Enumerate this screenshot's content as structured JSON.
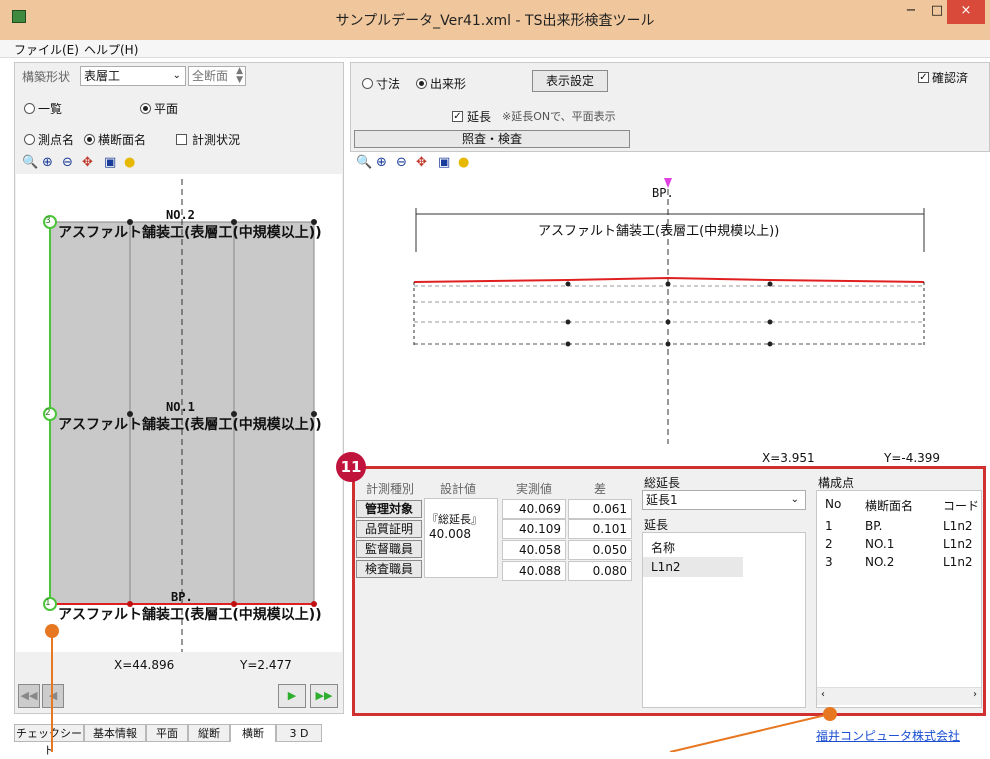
{
  "window": {
    "title": "サンプルデータ_Ver41.xml - TS出来形検査ツール",
    "min_label": "−",
    "max_label": "□",
    "close_label": "×",
    "accent_color": "#d94a3a"
  },
  "menu": {
    "file": "ファイル(E)",
    "help": "ヘルプ(H)"
  },
  "left_panel": {
    "shape_label": "構築形状",
    "shape_value": "表層工",
    "section_value": "全断面",
    "radio_list": "一覧",
    "radio_plan": "平面",
    "radio_point_name": "測点名",
    "radio_section_name": "横断面名",
    "check_measure": "計測状況",
    "drawing": {
      "sections": [
        {
          "station": "NO.2",
          "label": "アスファルト舗装工(表層工(中規模以上))",
          "marker": "3"
        },
        {
          "station": "NO.1",
          "label": "アスファルト舗装工(表層工(中規模以上))",
          "marker": "2"
        },
        {
          "station": "BP.",
          "label": "アスファルト舗装工(表層工(中規模以上))",
          "marker": "1"
        }
      ]
    },
    "coord_x": "X=44.896",
    "coord_y": "Y=2.477"
  },
  "right_panel": {
    "radio_dimension": "寸法",
    "radio_result": "出来形",
    "display_settings": "表示設定",
    "check_extension": "延長",
    "extension_note": "※延長ONで、平面表示",
    "check_title": "照査・検査",
    "confirmed_label": "確認済",
    "drawing": {
      "station": "BP.",
      "label": "アスファルト舗装工(表層工(中規模以上))"
    },
    "coord_x": "X=3.951",
    "coord_y": "Y=-4.399"
  },
  "callout": {
    "number": "11",
    "company_link": "福井コンピュータ株式会社"
  },
  "measure_table": {
    "headers": [
      "計測種別",
      "設計値",
      "実測値",
      "差"
    ],
    "types": [
      "管理対象",
      "品質証明",
      "監督職員",
      "検査職員"
    ],
    "design_label": "『総延長』",
    "design_value": "40.008",
    "rows": [
      {
        "measured": "40.069",
        "diff": "0.061"
      },
      {
        "measured": "40.109",
        "diff": "0.101"
      },
      {
        "measured": "40.058",
        "diff": "0.050"
      },
      {
        "measured": "40.088",
        "diff": "0.080"
      }
    ]
  },
  "total_length": {
    "label": "総延長",
    "selected": "延長1",
    "extension_label": "延長",
    "name_header": "名称",
    "name_value": "L1n2"
  },
  "points": {
    "label": "構成点",
    "headers": [
      "No",
      "横断面名",
      "コード"
    ],
    "rows": [
      {
        "no": "1",
        "name": "BP.",
        "code": "L1n2"
      },
      {
        "no": "2",
        "name": "NO.1",
        "code": "L1n2"
      },
      {
        "no": "3",
        "name": "NO.2",
        "code": "L1n2"
      }
    ]
  },
  "tabs": [
    "チェックシート",
    "基本情報",
    "平面",
    "縦断",
    "横断",
    "3 D"
  ],
  "active_tab": "横断"
}
